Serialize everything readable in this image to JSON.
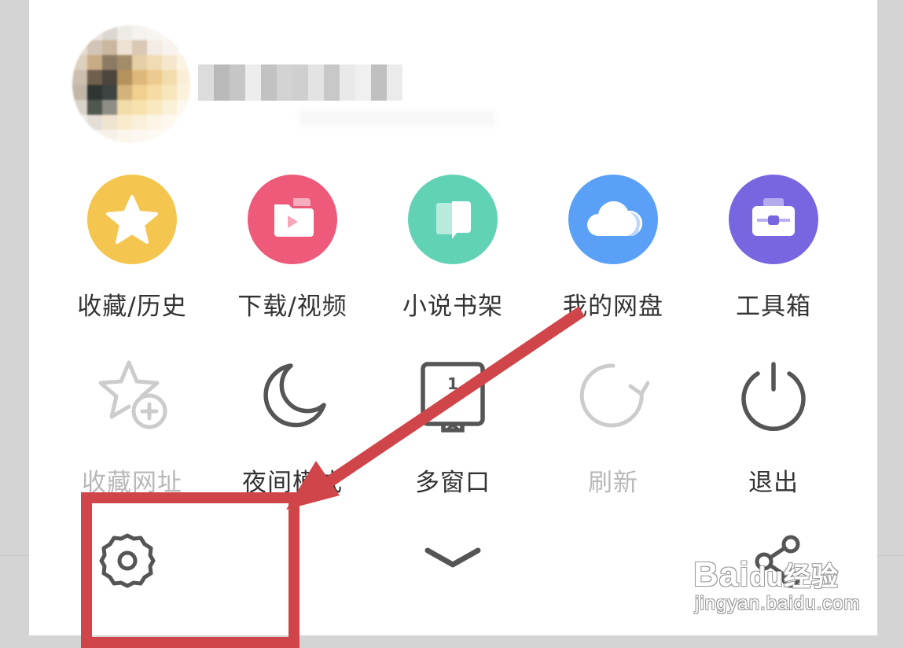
{
  "colors": {
    "favorites_history": "#f5c64f",
    "downloads_video": "#ed5a7a",
    "novel_shelf": "#62d2b4",
    "cloud_drive": "#5aa0f7",
    "toolbox": "#7766e0",
    "annotation_red": "#d0454a",
    "icon_dark": "#555555",
    "icon_dim": "#cccccc"
  },
  "grid_top": {
    "items": [
      {
        "label": "收藏/历史",
        "icon": "star-icon"
      },
      {
        "label": "下载/视频",
        "icon": "folder-play-icon"
      },
      {
        "label": "小说书架",
        "icon": "book-icon"
      },
      {
        "label": "我的网盘",
        "icon": "cloud-icon"
      },
      {
        "label": "工具箱",
        "icon": "toolbox-icon"
      }
    ]
  },
  "grid_bottom": {
    "items": [
      {
        "label": "收藏网址",
        "icon": "star-add-icon",
        "enabled": false
      },
      {
        "label": "夜间模式",
        "icon": "moon-icon",
        "enabled": true
      },
      {
        "label": "多窗口",
        "icon": "multi-window-icon",
        "enabled": true,
        "window_count": "1"
      },
      {
        "label": "刷新",
        "icon": "refresh-icon",
        "enabled": false
      },
      {
        "label": "退出",
        "icon": "power-icon",
        "enabled": true
      }
    ]
  },
  "bottom_bar": {
    "settings_icon": "gear-icon",
    "collapse_icon": "chevron-down-icon",
    "share_icon": "share-icon"
  },
  "watermark": {
    "brand": "Bai",
    "brand_mid": "du",
    "brand_suffix": "经验",
    "url": "jingyan.baidu.com"
  }
}
